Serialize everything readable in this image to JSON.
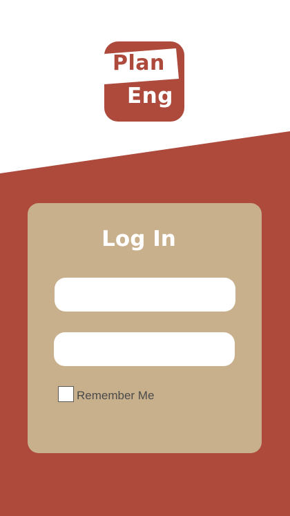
{
  "colors": {
    "brand": "#ad4a3c",
    "card": "#c8b08c",
    "field": "#ffffff",
    "background": "#ffffff"
  },
  "logo": {
    "line1": "Plan",
    "line2": "Eng"
  },
  "login": {
    "title": "Log In",
    "username": {
      "value": "",
      "placeholder": ""
    },
    "password": {
      "value": "",
      "placeholder": ""
    },
    "remember_label": "Remember Me",
    "remember_checked": false
  }
}
